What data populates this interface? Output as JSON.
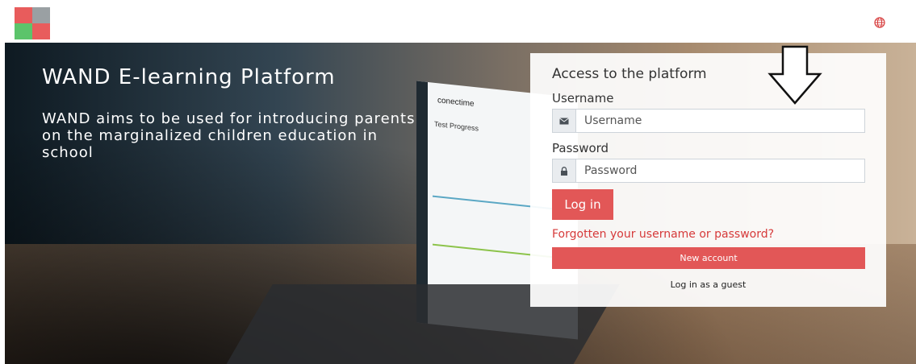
{
  "header": {
    "logo_icon": "puzzle-logo-icon",
    "logo_colors": [
      "#e85c5c",
      "#9aa0a3",
      "#5cc46b",
      "#e85c5c"
    ],
    "language_icon": "globe-icon",
    "accent": "#e25757"
  },
  "hero": {
    "title": "WAND E-learning Platform",
    "description": "WAND aims to be used for introducing parents on the marginalized children education in school",
    "laptop": {
      "brand": "conectime",
      "subtitle": "Test Progress"
    }
  },
  "login": {
    "heading": "Access to the platform",
    "username_label": "Username",
    "username_placeholder": "Username",
    "username_icon": "envelope-icon",
    "password_label": "Password",
    "password_placeholder": "Password",
    "password_icon": "lock-icon",
    "login_button": "Log in",
    "forgot_link": "Forgotten your username or password?",
    "new_account_button": "New account",
    "guest_link": "Log in as a guest"
  },
  "annotation": {
    "arrow_icon": "down-arrow-icon"
  }
}
